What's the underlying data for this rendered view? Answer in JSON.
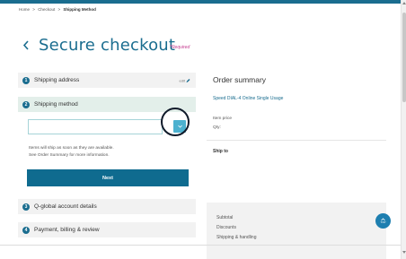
{
  "breadcrumb": {
    "home": "Home",
    "sep1": ">",
    "checkout": "Checkout",
    "sep2": ">",
    "current": "Shipping Method"
  },
  "page": {
    "back_icon": "chevron-left-icon",
    "title": "Secure checkout",
    "required_label": "*Required"
  },
  "steps": [
    {
      "number": "1",
      "label": "Shipping address",
      "edit_label": "edit"
    },
    {
      "number": "2",
      "label": "Shipping method"
    },
    {
      "number": "3",
      "label": "Q-global account details"
    },
    {
      "number": "4",
      "label": "Payment, billing & review"
    }
  ],
  "shipping_method": {
    "select_value": "",
    "select_icon": "chevron-down-icon",
    "note_line1": "Items will ship as soon as they are available.",
    "note_line2": "See Order Summary for more information.",
    "next_label": "Next"
  },
  "order_summary": {
    "title": "Order summary",
    "product": "Speed DIAL-4 Online Single Usage",
    "item_price_label": "Item price",
    "qty_label": "Qty:",
    "ship_to_label": "Ship to",
    "subtotal_label": "Subtotal",
    "discounts_label": "Discounts",
    "shipping_label": "Shipping & handling"
  },
  "scroll_top": {
    "icon": "arrow-up-icon",
    "label": "TOP"
  },
  "colors": {
    "brand": "#1a6d8f",
    "required": "#c43a8f",
    "select_button": "#4cb1cf",
    "next_button": "#0f6b8f"
  }
}
